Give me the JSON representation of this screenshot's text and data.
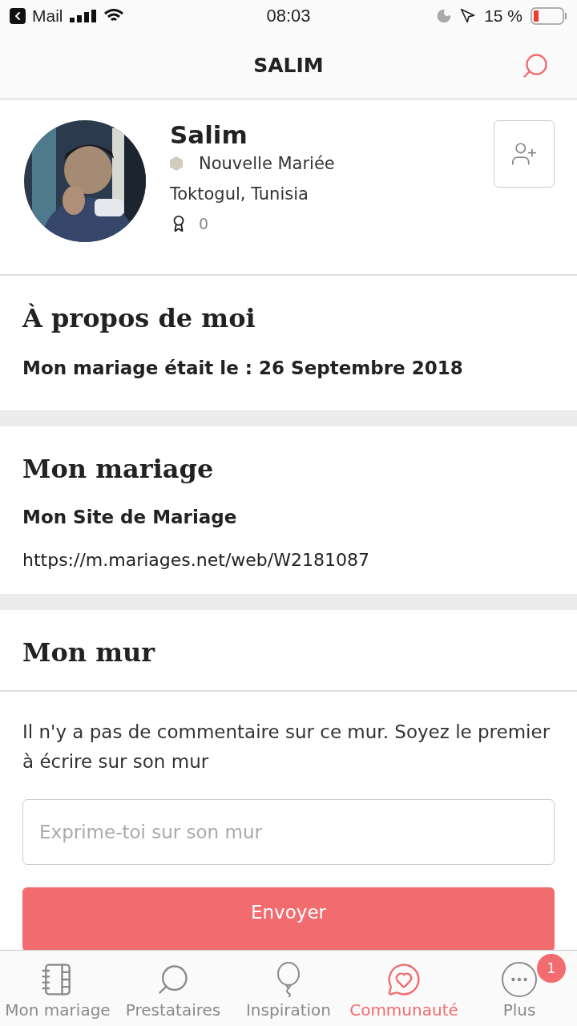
{
  "status_bar": {
    "back_app": "Mail",
    "time": "08:03",
    "battery_percent": "15 %"
  },
  "header": {
    "title": "SALIM"
  },
  "profile": {
    "name": "Salim",
    "role": "Nouvelle Mariée",
    "location": "Toktogul, Tunisia",
    "badges": "0"
  },
  "about": {
    "title": "À propos de moi",
    "text": "Mon mariage était le : 26 Septembre 2018"
  },
  "wedding": {
    "title": "Mon mariage",
    "subtitle": "Mon Site de Mariage",
    "url": "https://m.mariages.net/web/W2181087"
  },
  "wall": {
    "title": "Mon mur",
    "empty_text": "Il n'y a pas de commentaire sur ce mur. Soyez le premier à écrire sur son mur",
    "placeholder": "Exprime-toi sur son mur",
    "send_button": "Envoyer"
  },
  "tab_bar": [
    {
      "kind": "notebook",
      "label": "Mon mariage",
      "selected": false
    },
    {
      "kind": "search",
      "label": "Prestataires",
      "selected": false
    },
    {
      "kind": "balloon",
      "label": "Inspiration",
      "selected": false
    },
    {
      "kind": "chat",
      "label": "Communauté",
      "selected": true
    },
    {
      "kind": "more",
      "label": "Plus",
      "selected": false,
      "badge": "1"
    }
  ]
}
